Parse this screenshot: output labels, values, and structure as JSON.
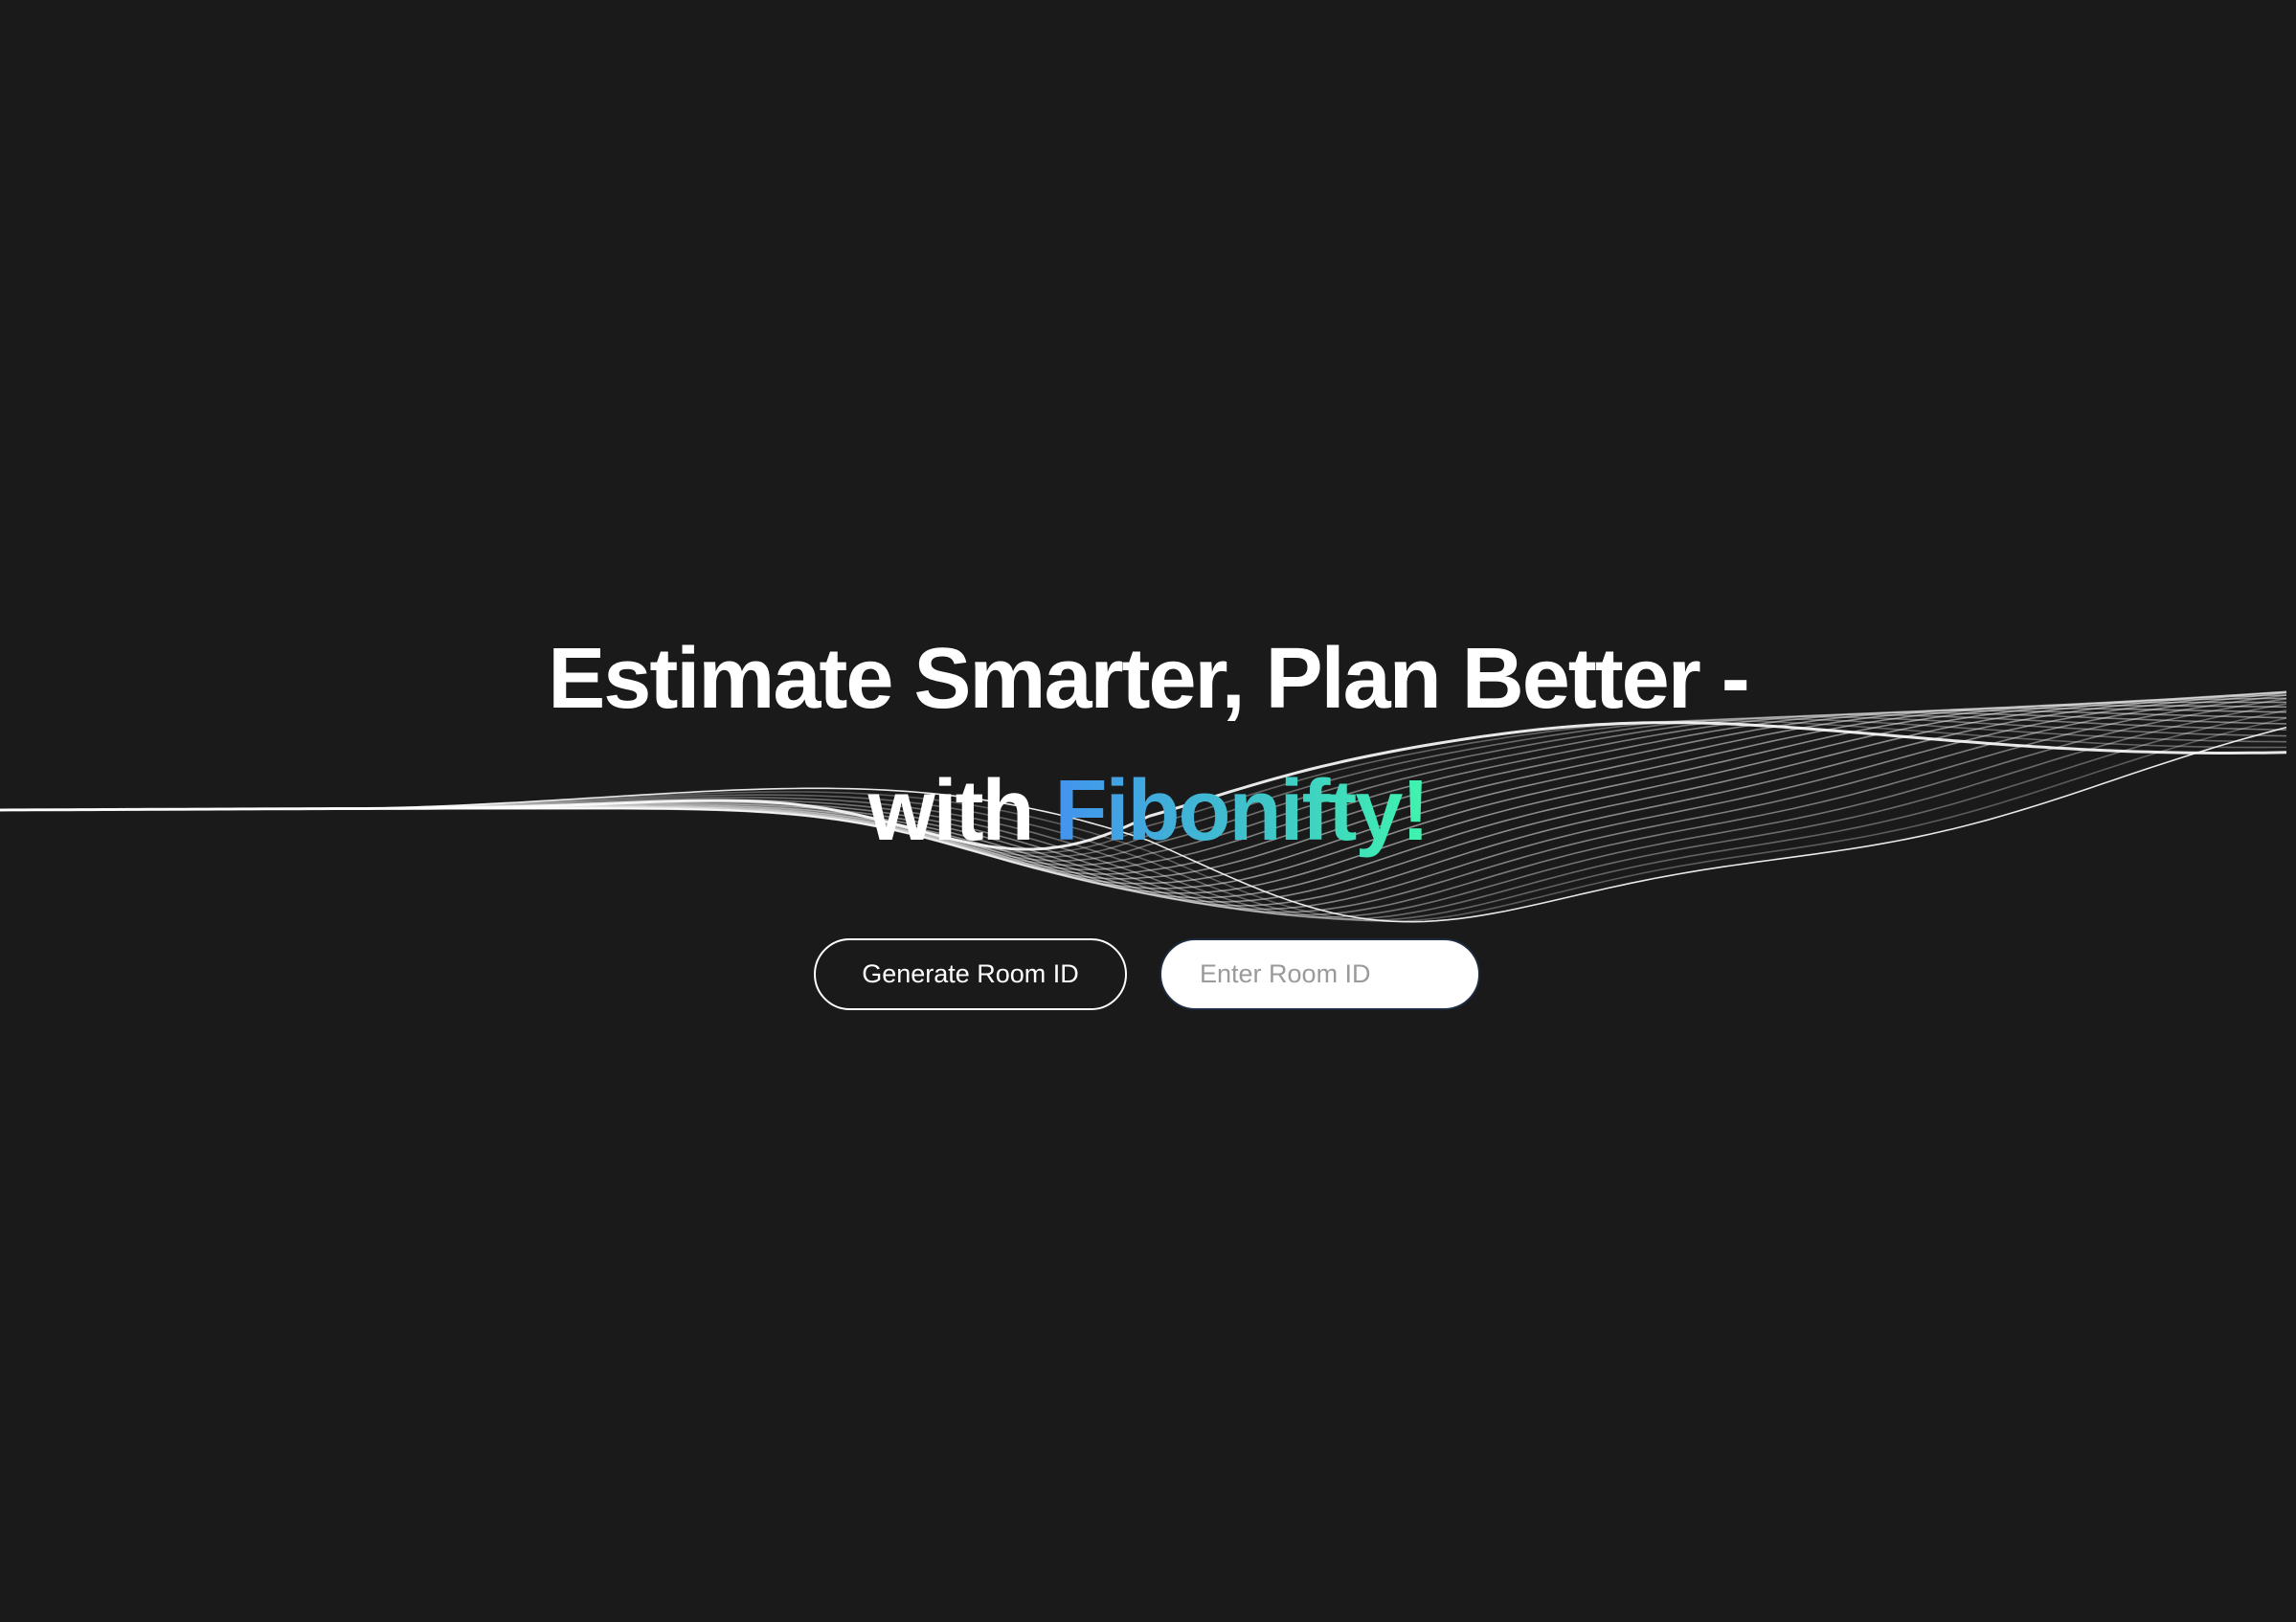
{
  "hero": {
    "line1": "Estimate Smarter, Plan Better -",
    "line2_prefix": "with ",
    "brand": "Fibonifty!"
  },
  "actions": {
    "generate_label": "Generate Room ID",
    "room_placeholder": "Enter Room ID"
  },
  "colors": {
    "background": "#1a1a1a",
    "brand_gradient_start": "#4393ef",
    "brand_gradient_end": "#3ff5ad"
  }
}
